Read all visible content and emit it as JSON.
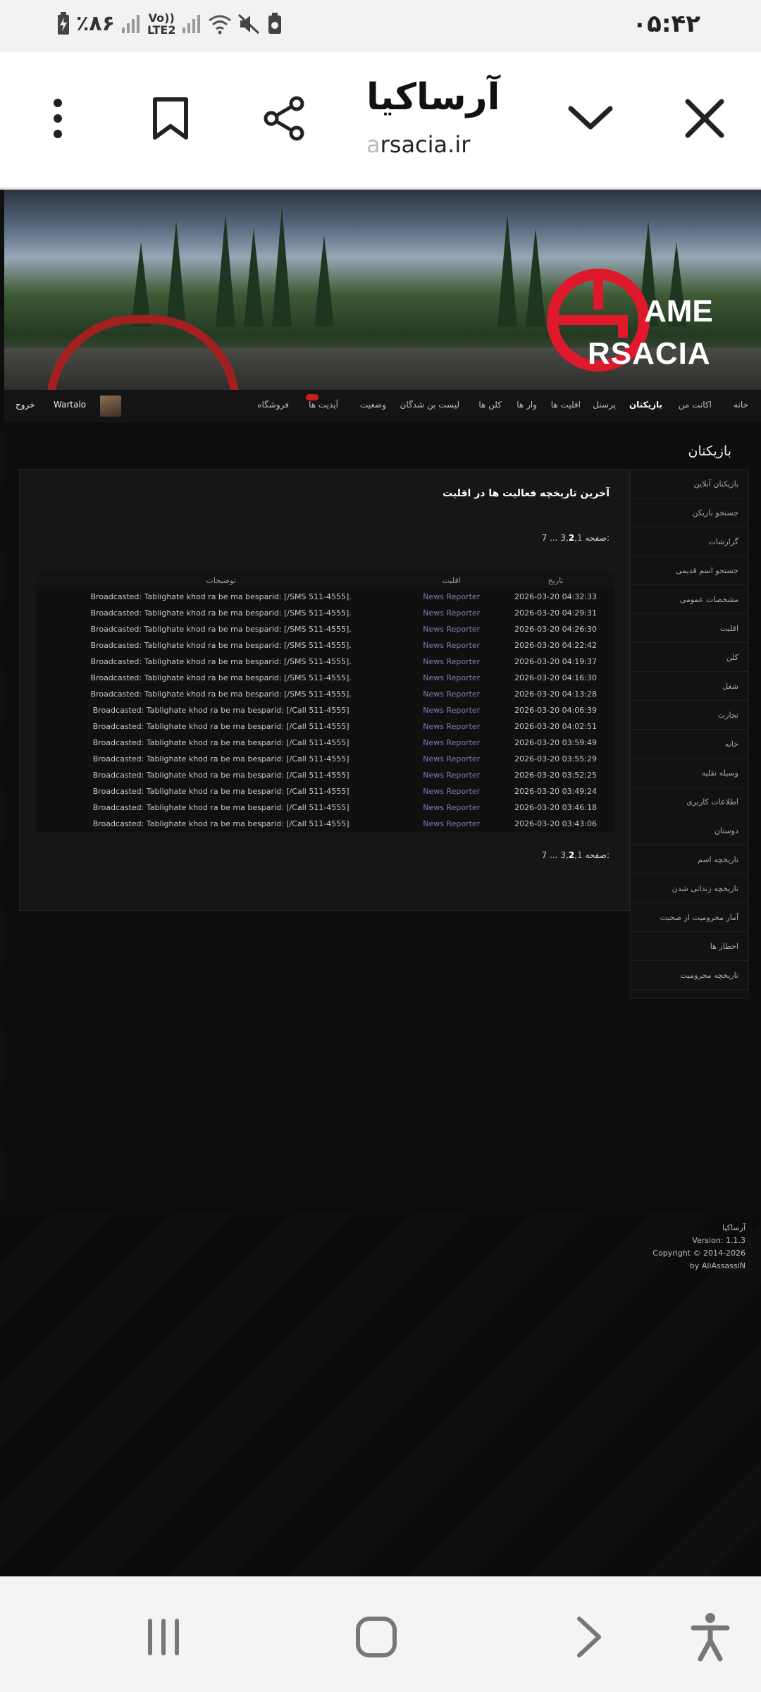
{
  "status_bar": {
    "time": "۰۵:۴۲",
    "battery": "٪۸۶",
    "lte_line1": "Vo))",
    "lte_line2": "LTE2"
  },
  "browser": {
    "title": "آرساکیا",
    "url_faded": "a",
    "url": "rsacia.ir",
    "icons": [
      "close-icon",
      "chevron-down-icon",
      "share-icon",
      "bookmark-icon",
      "more-vert-icon"
    ]
  },
  "site": {
    "logo_text_top": "AME",
    "logo_text_bottom": "RSACIA",
    "nav": {
      "home": "خانه",
      "my_account": "اکانت من",
      "players": "بازیکنان",
      "staff": "پرسنل",
      "factions": "اقلیت ها",
      "wars": "وار ها",
      "clans": "کلن ها",
      "banned": "لیست بن شدگان",
      "status": "وضعیت",
      "updates": "آپدیت ها",
      "shop": "فروشگاه",
      "username": "Wartalo",
      "logout": "خروج"
    },
    "section_title": "بازیکنان",
    "sidebar": [
      "بازیکنان آنلاین",
      "جستجو بازیکن",
      "گزارشات",
      "جستجو اسم قدیمی",
      "مشخصات عمومی",
      "اقلیت",
      "کلن",
      "شغل",
      "تجارت",
      "خانه",
      "وسیله نقلیه",
      "اطلاعات کاربری",
      "دوستان",
      "تاریخچه اسم",
      "تاریخچه زندانی شدن",
      "آمار محرومیت از صحبت",
      "اخطار ها",
      "تاریخچه محرومیت"
    ],
    "panel": {
      "heading": "آخرین تاریخچه فعالیت ها در اقلیت",
      "pager": {
        "label": "صفحه:",
        "p1": "1",
        "p2": "2",
        "p3": "3",
        "dots": "...",
        "last": "7"
      },
      "table": {
        "headers": {
          "date": "تاریخ",
          "faction": "اقلیت",
          "description": "توضیحات"
        },
        "rows": [
          {
            "date": "2026-03-20 04:32:33",
            "faction": "News Reporter",
            "desc": "Broadcasted: Tablighate khod ra be ma besparid: [/SMS 511-4555]."
          },
          {
            "date": "2026-03-20 04:29:31",
            "faction": "News Reporter",
            "desc": "Broadcasted: Tablighate khod ra be ma besparid: [/SMS 511-4555]."
          },
          {
            "date": "2026-03-20 04:26:30",
            "faction": "News Reporter",
            "desc": "Broadcasted: Tablighate khod ra be ma besparid: [/SMS 511-4555]."
          },
          {
            "date": "2026-03-20 04:22:42",
            "faction": "News Reporter",
            "desc": "Broadcasted: Tablighate khod ra be ma besparid: [/SMS 511-4555]."
          },
          {
            "date": "2026-03-20 04:19:37",
            "faction": "News Reporter",
            "desc": "Broadcasted: Tablighate khod ra be ma besparid: [/SMS 511-4555]."
          },
          {
            "date": "2026-03-20 04:16:30",
            "faction": "News Reporter",
            "desc": "Broadcasted: Tablighate khod ra be ma besparid: [/SMS 511-4555]."
          },
          {
            "date": "2026-03-20 04:13:28",
            "faction": "News Reporter",
            "desc": "Broadcasted: Tablighate khod ra be ma besparid: [/SMS 511-4555]."
          },
          {
            "date": "2026-03-20 04:06:39",
            "faction": "News Reporter",
            "desc": "Broadcasted: Tablighate khod ra be ma besparid: [/Call 511-4555]"
          },
          {
            "date": "2026-03-20 04:02:51",
            "faction": "News Reporter",
            "desc": "Broadcasted: Tablighate khod ra be ma besparid: [/Call 511-4555]"
          },
          {
            "date": "2026-03-20 03:59:49",
            "faction": "News Reporter",
            "desc": "Broadcasted: Tablighate khod ra be ma besparid: [/Call 511-4555]"
          },
          {
            "date": "2026-03-20 03:55:29",
            "faction": "News Reporter",
            "desc": "Broadcasted: Tablighate khod ra be ma besparid: [/Call 511-4555]"
          },
          {
            "date": "2026-03-20 03:52:25",
            "faction": "News Reporter",
            "desc": "Broadcasted: Tablighate khod ra be ma besparid: [/Call 511-4555]"
          },
          {
            "date": "2026-03-20 03:49:24",
            "faction": "News Reporter",
            "desc": "Broadcasted: Tablighate khod ra be ma besparid: [/Call 511-4555]"
          },
          {
            "date": "2026-03-20 03:46:18",
            "faction": "News Reporter",
            "desc": "Broadcasted: Tablighate khod ra be ma besparid: [/Call 511-4555]"
          },
          {
            "date": "2026-03-20 03:43:06",
            "faction": "News Reporter",
            "desc": "Broadcasted: Tablighate khod ra be ma besparid: [/Call 511-4555]"
          }
        ]
      }
    },
    "footer": {
      "name": "آرساکیا",
      "version": "Version: 1.1.3",
      "copyright": "Copyright © 2014-2026",
      "author": "by AliAssassiN"
    },
    "colors": {
      "faction_link": "#8e73b3",
      "logo_red": "#e0182b",
      "page_bg": "#0d0d0d"
    }
  },
  "android_nav": {
    "icons": [
      "recents-icon",
      "home-icon",
      "back-icon",
      "accessibility-icon"
    ]
  }
}
